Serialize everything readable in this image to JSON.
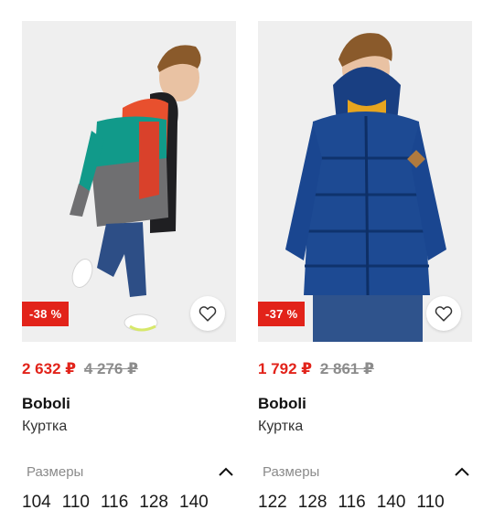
{
  "products": [
    {
      "discount": "-38 %",
      "price_now": "2 632 ₽",
      "price_old": "4 276 ₽",
      "brand": "Boboli",
      "type": "Куртка",
      "sizes_label": "Размеры",
      "sizes": [
        "104",
        "110",
        "116",
        "128",
        "140"
      ]
    },
    {
      "discount": "-37 %",
      "price_now": "1 792 ₽",
      "price_old": "2 861 ₽",
      "brand": "Boboli",
      "type": "Куртка",
      "sizes_label": "Размеры",
      "sizes": [
        "122",
        "128",
        "116",
        "140",
        "110"
      ]
    }
  ],
  "colors": {
    "accent": "#e2231a",
    "muted": "#8c8c8c"
  },
  "icons": {
    "favorite": "heart-icon",
    "collapse": "chevron-up-icon"
  }
}
